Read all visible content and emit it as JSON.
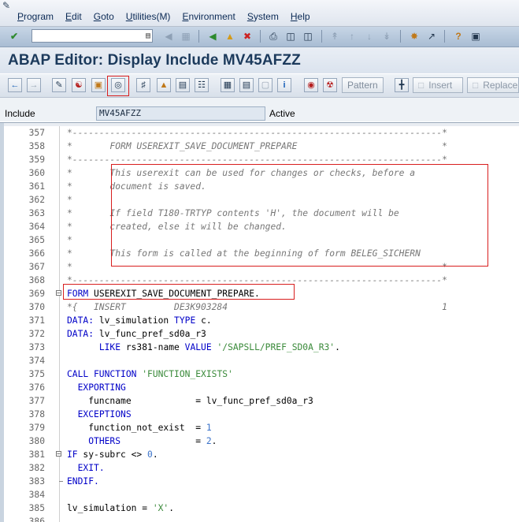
{
  "menubar": {
    "items": [
      "Program",
      "Edit",
      "Goto",
      "Utilities(M)",
      "Environment",
      "System",
      "Help"
    ]
  },
  "std_toolbar": {
    "command_field_value": "",
    "icons": [
      "enter-icon",
      "back-icon",
      "save-icon",
      "back-green-icon",
      "exit-icon",
      "cancel-icon",
      "print-icon",
      "find-icon",
      "find-next-icon",
      "first-page-icon",
      "prev-page-icon",
      "next-page-icon",
      "last-page-icon",
      "new-session-icon",
      "shortcut-icon",
      "help-icon",
      "customize-layout-icon"
    ]
  },
  "title": "ABAP Editor: Display Include MV45AFZZ",
  "app_toolbar": {
    "icons": [
      "back-arrow-icon",
      "forward-arrow-icon",
      "display-change-icon",
      "active-inactive-icon",
      "other-object-icon",
      "where-used-icon",
      "check-icon",
      "activate-icon",
      "test-icon",
      "object-list-icon",
      "navigation-window-icon",
      "enhance-icon",
      "stop-icon",
      "display-object-list-icon",
      "fullscreen-icon",
      "info-icon",
      "breakpoint-icon",
      "delete-breakpoint-icon",
      "pattern-icon",
      "insert-icon",
      "replace-icon"
    ],
    "pattern_label": "Pattern",
    "insert_label": "Insert",
    "replace_label": "Replace"
  },
  "include_row": {
    "label": "Include",
    "value": "MV45AFZZ",
    "status": "Active"
  },
  "code_lines": [
    {
      "n": "357",
      "text": "*---------------------------------------------------------------------*",
      "type": "comment"
    },
    {
      "n": "358",
      "text": "*       FORM USEREXIT_SAVE_DOCUMENT_PREPARE                           *",
      "type": "comment"
    },
    {
      "n": "359",
      "text": "*---------------------------------------------------------------------*",
      "type": "comment"
    },
    {
      "n": "360",
      "text": "*       This userexit can be used for changes or checks, before a",
      "type": "comment"
    },
    {
      "n": "361",
      "text": "*       document is saved.",
      "type": "comment"
    },
    {
      "n": "362",
      "text": "*",
      "type": "comment"
    },
    {
      "n": "363",
      "text": "*       If field T180-TRTYP contents 'H', the document will be",
      "type": "comment"
    },
    {
      "n": "364",
      "text": "*       created, else it will be changed.",
      "type": "comment"
    },
    {
      "n": "365",
      "text": "*",
      "type": "comment"
    },
    {
      "n": "366",
      "text": "*       This form is called at the beginning of form BELEG_SICHERN",
      "type": "comment"
    },
    {
      "n": "367",
      "text": "*                                                                     *",
      "type": "comment"
    },
    {
      "n": "368",
      "text": "*---------------------------------------------------------------------*",
      "type": "comment"
    },
    {
      "n": "369",
      "kw": "FORM",
      "rest": " USEREXIT_SAVE_DOCUMENT_PREPARE.",
      "type": "form"
    },
    {
      "n": "370",
      "text": "*{   INSERT         DE3K903284                                        1",
      "type": "insert"
    },
    {
      "n": "371",
      "kw": "DATA:",
      "a": " lv_simulation ",
      "kw2": "TYPE",
      "b": " c.",
      "type": "data"
    },
    {
      "n": "372",
      "kw": "DATA:",
      "a": " lv_func_pref_sd0a_r3",
      "type": "data1"
    },
    {
      "n": "373",
      "pre": "      ",
      "kw": "LIKE",
      "a": " rs381-name ",
      "kw2": "VALUE",
      "str": " '/SAPSLL/PREF_SD0A_R3'",
      "b": ".",
      "type": "like"
    },
    {
      "n": "374",
      "text": "",
      "type": "blank"
    },
    {
      "n": "375",
      "kw": "CALL FUNCTION",
      "str": " 'FUNCTION_EXISTS'",
      "type": "call"
    },
    {
      "n": "376",
      "pre": "  ",
      "kw": "EXPORTING",
      "type": "kwonly"
    },
    {
      "n": "377",
      "a": "    funcname            = lv_func_pref_sd0a_r3",
      "type": "plain"
    },
    {
      "n": "378",
      "pre": "  ",
      "kw": "EXCEPTIONS",
      "type": "kwonly"
    },
    {
      "n": "379",
      "a": "    function_not_exist  = ",
      "num": "1",
      "type": "assignnum"
    },
    {
      "n": "380",
      "pre": "    ",
      "kw": "OTHERS",
      "a": "              = ",
      "num": "2",
      "b": ".",
      "type": "others"
    },
    {
      "n": "381",
      "kw": "IF",
      "a": " sy-subrc <> ",
      "num": "0",
      "b": ".",
      "type": "if"
    },
    {
      "n": "382",
      "pre": "  ",
      "kw": "EXIT.",
      "type": "kwonly"
    },
    {
      "n": "383",
      "kw": "ENDIF.",
      "type": "kwonly"
    },
    {
      "n": "384",
      "text": "",
      "type": "blank"
    },
    {
      "n": "385",
      "a": "lv_simulation = ",
      "str": "'X'",
      "b": ".",
      "type": "assignstr"
    },
    {
      "n": "386",
      "text": "",
      "type": "blank"
    }
  ],
  "colors": {
    "highlight": "#d81e1e",
    "keyword": "#0000c8",
    "string": "#3a8a3a",
    "number": "#3a72c9",
    "comment": "#777777"
  }
}
